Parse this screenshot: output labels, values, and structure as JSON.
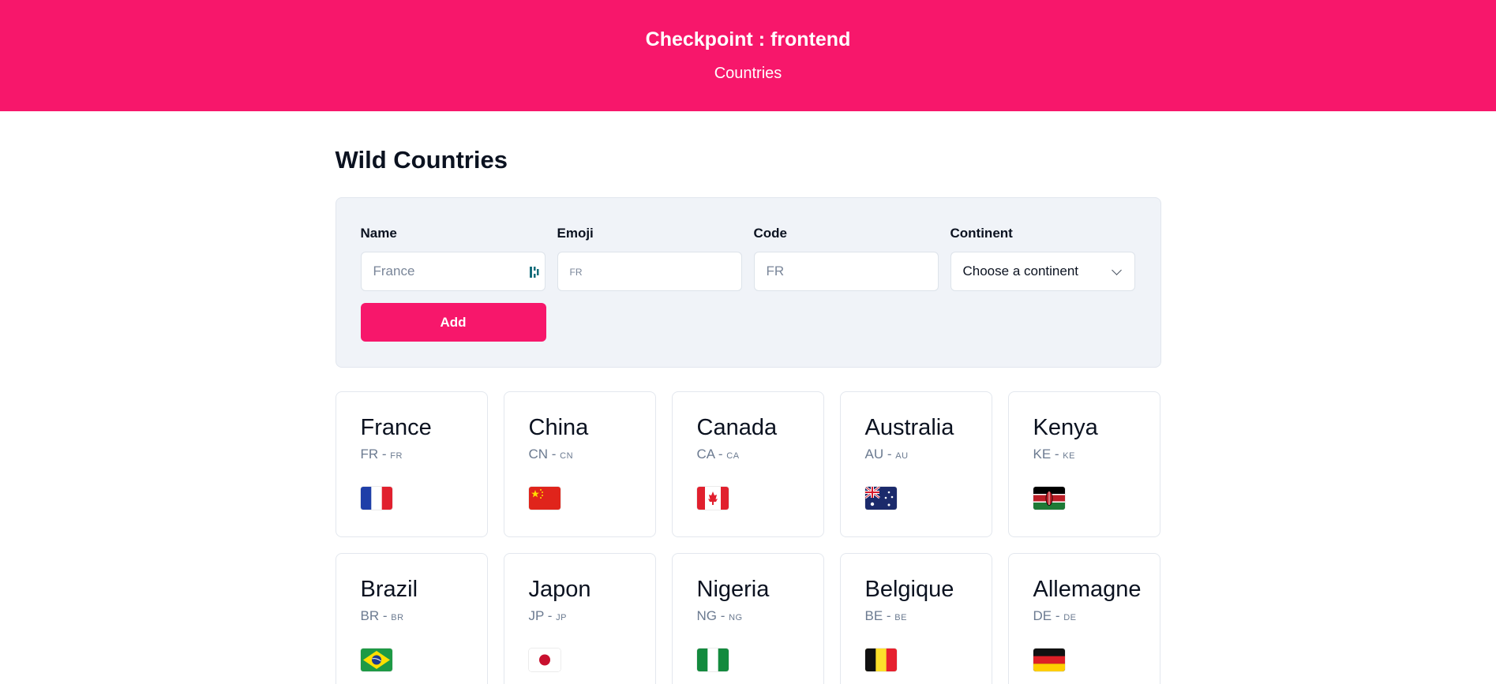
{
  "header": {
    "title": "Checkpoint : frontend",
    "subtitle": "Countries",
    "background": "#f7176b"
  },
  "main": {
    "title": "Wild Countries"
  },
  "form": {
    "name_label": "Name",
    "name_placeholder": "France",
    "emoji_label": "Emoji",
    "emoji_placeholder": "FR",
    "code_label": "Code",
    "code_placeholder": "FR",
    "continent_label": "Continent",
    "continent_value": "Choose a continent",
    "add_label": "Add"
  },
  "countries": [
    {
      "name": "France",
      "code": "FR",
      "emoji": "FR",
      "flag_icon": "flag-fr"
    },
    {
      "name": "China",
      "code": "CN",
      "emoji": "CN",
      "flag_icon": "flag-cn"
    },
    {
      "name": "Canada",
      "code": "CA",
      "emoji": "CA",
      "flag_icon": "flag-ca"
    },
    {
      "name": "Australia",
      "code": "AU",
      "emoji": "AU",
      "flag_icon": "flag-au"
    },
    {
      "name": "Kenya",
      "code": "KE",
      "emoji": "KE",
      "flag_icon": "flag-ke"
    },
    {
      "name": "Brazil",
      "code": "BR",
      "emoji": "BR",
      "flag_icon": "flag-br"
    },
    {
      "name": "Japon",
      "code": "JP",
      "emoji": "JP",
      "flag_icon": "flag-jp"
    },
    {
      "name": "Nigeria",
      "code": "NG",
      "emoji": "NG",
      "flag_icon": "flag-ng"
    },
    {
      "name": "Belgique",
      "code": "BE",
      "emoji": "BE",
      "flag_icon": "flag-be"
    },
    {
      "name": "Allemagne",
      "code": "DE",
      "emoji": "DE",
      "flag_icon": "flag-de"
    }
  ]
}
